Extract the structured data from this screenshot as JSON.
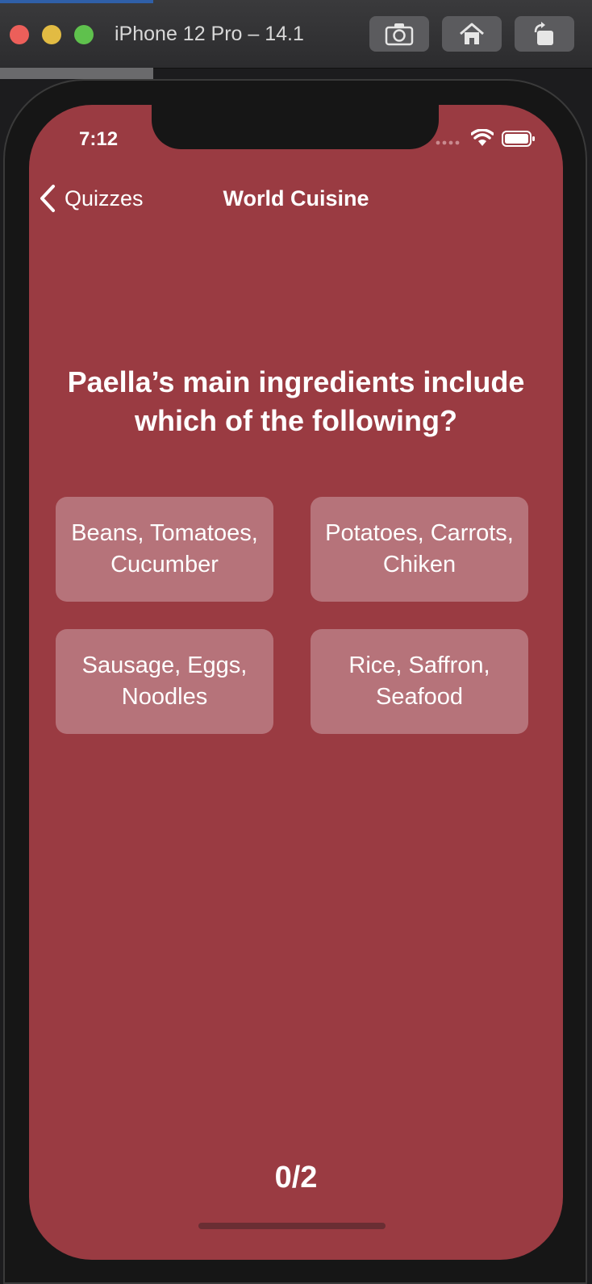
{
  "simulator": {
    "title": "iPhone 12 Pro – 14.1",
    "buttons": [
      "camera-icon",
      "home-icon",
      "rotate-icon"
    ]
  },
  "status_bar": {
    "time": "7:12"
  },
  "nav": {
    "back_label": "Quizzes",
    "title": "World Cuisine"
  },
  "quiz": {
    "question": "Paella’s main ingredients include which of the following?",
    "answers": [
      {
        "label": "Beans, Tomatoes, Cucumber"
      },
      {
        "label": "Potatoes, Carrots, Chiken"
      },
      {
        "label": "Sausage, Eggs, Noodles"
      },
      {
        "label": "Rice, Saffron, Seafood"
      }
    ],
    "score": "0/2"
  },
  "colors": {
    "background": "#9a3b42",
    "answer_button": "#b6737a",
    "text": "#ffffff"
  }
}
